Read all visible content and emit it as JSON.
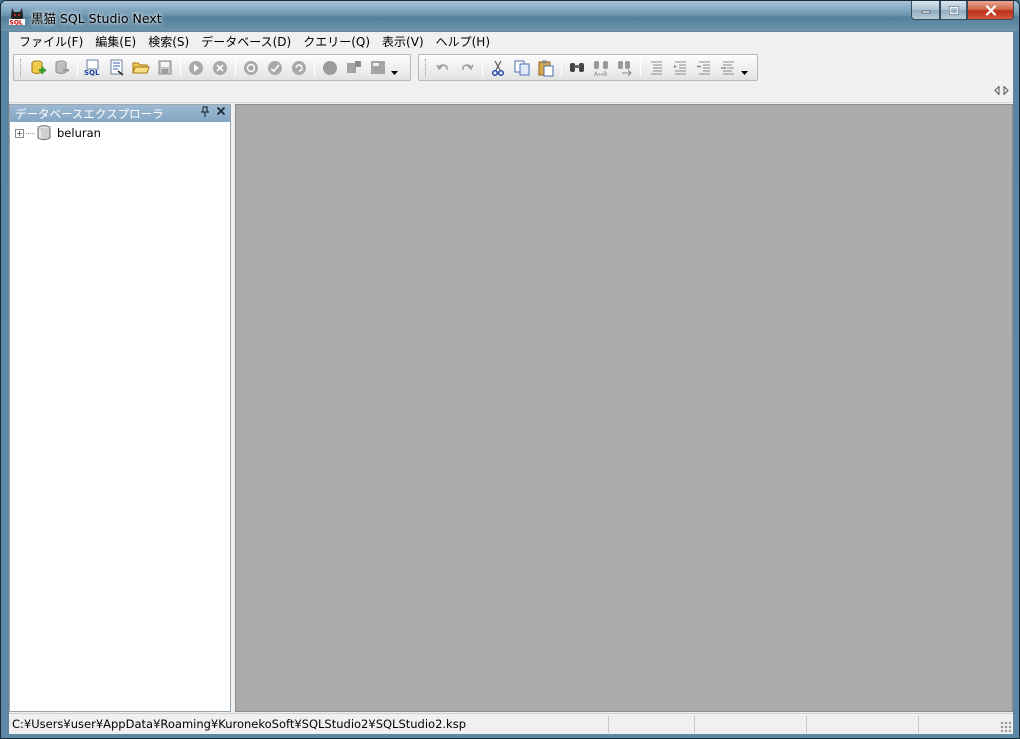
{
  "window": {
    "title": "黒猫 SQL Studio Next",
    "icon": "black-cat-sql-icon"
  },
  "window_controls": {
    "minimize": "minimize-icon",
    "maximize": "maximize-icon",
    "close": "close-icon"
  },
  "menu": {
    "items": [
      {
        "label": "ファイル(F)"
      },
      {
        "label": "編集(E)"
      },
      {
        "label": "検索(S)"
      },
      {
        "label": "データベース(D)"
      },
      {
        "label": "クエリー(Q)"
      },
      {
        "label": "表示(V)"
      },
      {
        "label": "ヘルプ(H)"
      }
    ]
  },
  "toolbar1": {
    "icons": [
      "new-connection-icon",
      "disconnect-icon",
      "new-sql-icon",
      "new-query-file-icon",
      "open-folder-icon",
      "save-icon",
      "execute-icon",
      "stop-icon",
      "commit-icon",
      "rollback-icon",
      "refresh-icon",
      "object-icon",
      "table-icon",
      "options-icon"
    ]
  },
  "toolbar2": {
    "icons": [
      "undo-icon",
      "redo-icon",
      "cut-icon",
      "copy-icon",
      "paste-icon",
      "find-icon",
      "replace-icon",
      "find-next-icon",
      "comment-icon",
      "uncomment-icon",
      "indent-icon",
      "outdent-icon"
    ]
  },
  "explorer": {
    "title": "データベースエクスプローラ",
    "tree": [
      {
        "label": "beluran",
        "expander": "+"
      }
    ]
  },
  "statusbar": {
    "path": "C:¥Users¥user¥AppData¥Roaming¥KuronekoSoft¥SQLStudio2¥SQLStudio2.ksp"
  },
  "colors": {
    "editor_bg": "#ababab",
    "explorer_header": "#9db9d2",
    "titlebar": "#6f98b3",
    "close_button": "#c43b20"
  }
}
